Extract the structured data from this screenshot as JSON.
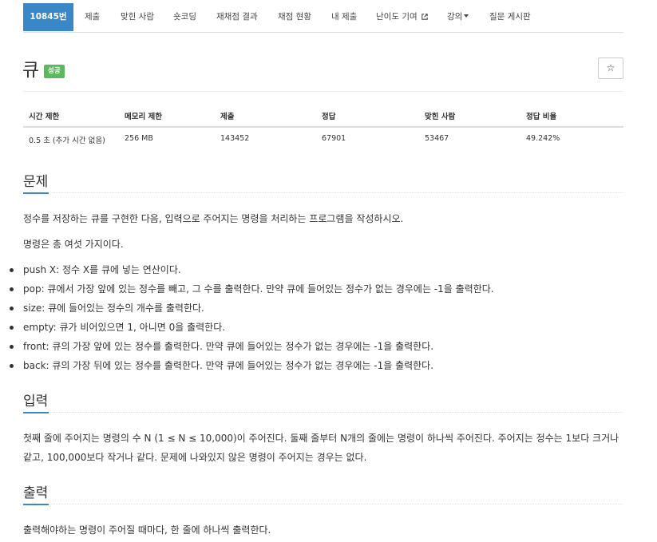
{
  "nav": {
    "problem_id": "10845번",
    "tabs": [
      "제출",
      "맞힌 사람",
      "숏코딩",
      "재채점 결과",
      "채점 현황",
      "내 제출",
      "난이도 기여",
      "강의",
      "질문 게시판"
    ]
  },
  "problem": {
    "title": "큐",
    "badge": "성공",
    "star_icon": "☆"
  },
  "stats": {
    "headers": [
      "시간 제한",
      "메모리 제한",
      "제출",
      "정답",
      "맞힌 사람",
      "정답 비율"
    ],
    "values": [
      "0.5 초 (추가 시간 없음)",
      "256 MB",
      "143452",
      "67901",
      "53467",
      "49.242%"
    ]
  },
  "description": {
    "heading": "문제",
    "paragraphs": [
      "정수를 저장하는 큐를 구현한 다음, 입력으로 주어지는 명령을 처리하는 프로그램을 작성하시오.",
      "명령은 총 여섯 가지이다."
    ],
    "commands": [
      "push X: 정수 X를 큐에 넣는 연산이다.",
      "pop: 큐에서 가장 앞에 있는 정수를 빼고, 그 수를 출력한다. 만약 큐에 들어있는 정수가 없는 경우에는 -1을 출력한다.",
      "size: 큐에 들어있는 정수의 개수를 출력한다.",
      "empty: 큐가 비어있으면 1, 아니면 0을 출력한다.",
      "front: 큐의 가장 앞에 있는 정수를 출력한다. 만약 큐에 들어있는 정수가 없는 경우에는 -1을 출력한다.",
      "back: 큐의 가장 뒤에 있는 정수를 출력한다. 만약 큐에 들어있는 정수가 없는 경우에는 -1을 출력한다."
    ]
  },
  "input": {
    "heading": "입력",
    "text": "첫째 줄에 주어지는 명령의 수 N (1 ≤ N ≤ 10,000)이 주어진다. 둘째 줄부터 N개의 줄에는 명령이 하나씩 주어진다. 주어지는 정수는 1보다 크거나 같고, 100,000보다 작거나 같다. 문제에 나와있지 않은 명령이 주어지는 경우는 없다."
  },
  "output": {
    "heading": "출력",
    "text": "출력해야하는 명령이 주어질 때마다, 한 줄에 하나씩 출력한다."
  },
  "colors": {
    "accent": "#3a87c8",
    "success": "#5cb85c"
  }
}
